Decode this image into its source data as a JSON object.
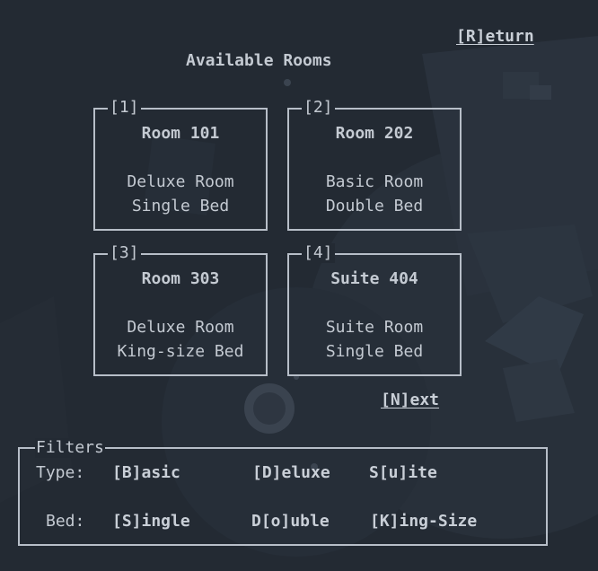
{
  "header": {
    "title": "Available Rooms",
    "return_label": "[R]eturn"
  },
  "rooms": [
    {
      "key": "[1]",
      "name": "Room 101",
      "type": "Deluxe Room",
      "bed": "Single Bed"
    },
    {
      "key": "[2]",
      "name": "Room 202",
      "type": "Basic Room",
      "bed": "Double Bed"
    },
    {
      "key": "[3]",
      "name": "Room 303",
      "type": "Deluxe Room",
      "bed": "King-size Bed"
    },
    {
      "key": "[4]",
      "name": "Suite 404",
      "type": "Suite Room",
      "bed": "Single Bed"
    }
  ],
  "pagination": {
    "next_label": "[N]ext"
  },
  "filters": {
    "legend": "Filters",
    "type_label": "Type:",
    "type_options": [
      "[B]asic",
      "[D]eluxe",
      "S[u]ite"
    ],
    "bed_label": "Bed:",
    "bed_options": [
      "[S]ingle",
      "D[o]uble",
      "[K]ing-Size"
    ]
  },
  "colors": {
    "background": "#232a33",
    "text": "#c4cad2",
    "border": "#b7bec8"
  }
}
